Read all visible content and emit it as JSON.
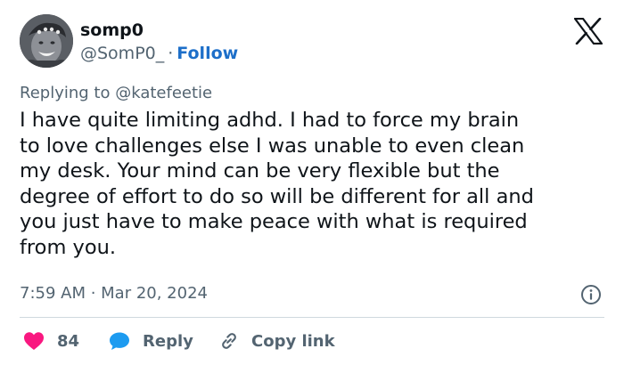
{
  "author": {
    "display_name": "somp0",
    "handle": "@SomP0_",
    "separator": "·",
    "follow_label": "Follow"
  },
  "reply_context": {
    "prefix": "Replying to",
    "mention": "@katefeetie"
  },
  "tweet": {
    "text": "I have quite limiting adhd. I had to force my brain\nto love challenges else I was unable to even clean\nmy desk. Your mind can be very flexible but the\ndegree of effort to do so will be different for all and\nyou just have to make peace with what is required\nfrom you.",
    "timestamp": "7:59 AM · Mar 20, 2024"
  },
  "actions": {
    "like_count": "84",
    "reply_label": "Reply",
    "copy_link_label": "Copy link"
  },
  "icons": {
    "logo": "x-logo",
    "info": "info-icon",
    "like": "heart-icon",
    "reply": "speech-bubble-icon",
    "copy": "link-icon"
  },
  "colors": {
    "text_primary": "#0f1419",
    "text_secondary": "#536471",
    "link": "#1d6fc9",
    "heart": "#f91880",
    "reply_bubble": "#1d9bf0",
    "divider": "#cfd9de"
  }
}
